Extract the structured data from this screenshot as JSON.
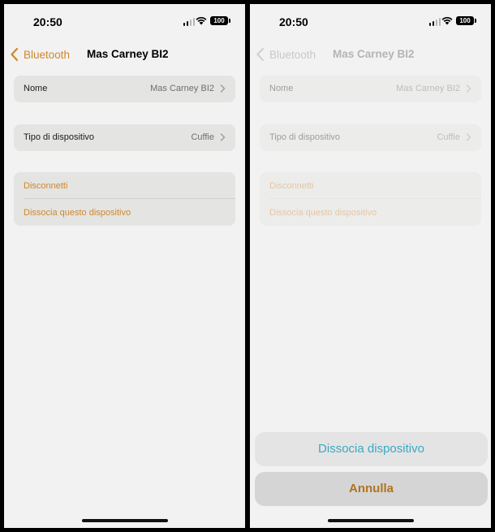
{
  "status_bar": {
    "time": "20:50",
    "battery": "100"
  },
  "nav": {
    "back_label": "Bluetooth",
    "title": "Mas Carney BI2"
  },
  "settings": {
    "name_label": "Nome",
    "name_value": "Mas Carney BI2",
    "type_label": "Tipo di dispositivo",
    "type_value": "Cuffie",
    "disconnect_label": "Disconnetti",
    "forget_label": "Dissocia questo dispositivo"
  },
  "action_sheet": {
    "confirm_label": "Dissocia dispositivo",
    "cancel_label": "Annulla"
  },
  "colors": {
    "accent": "#d0872c",
    "sheet_confirm": "#3aa9c4",
    "background": "#f2f2f2"
  }
}
